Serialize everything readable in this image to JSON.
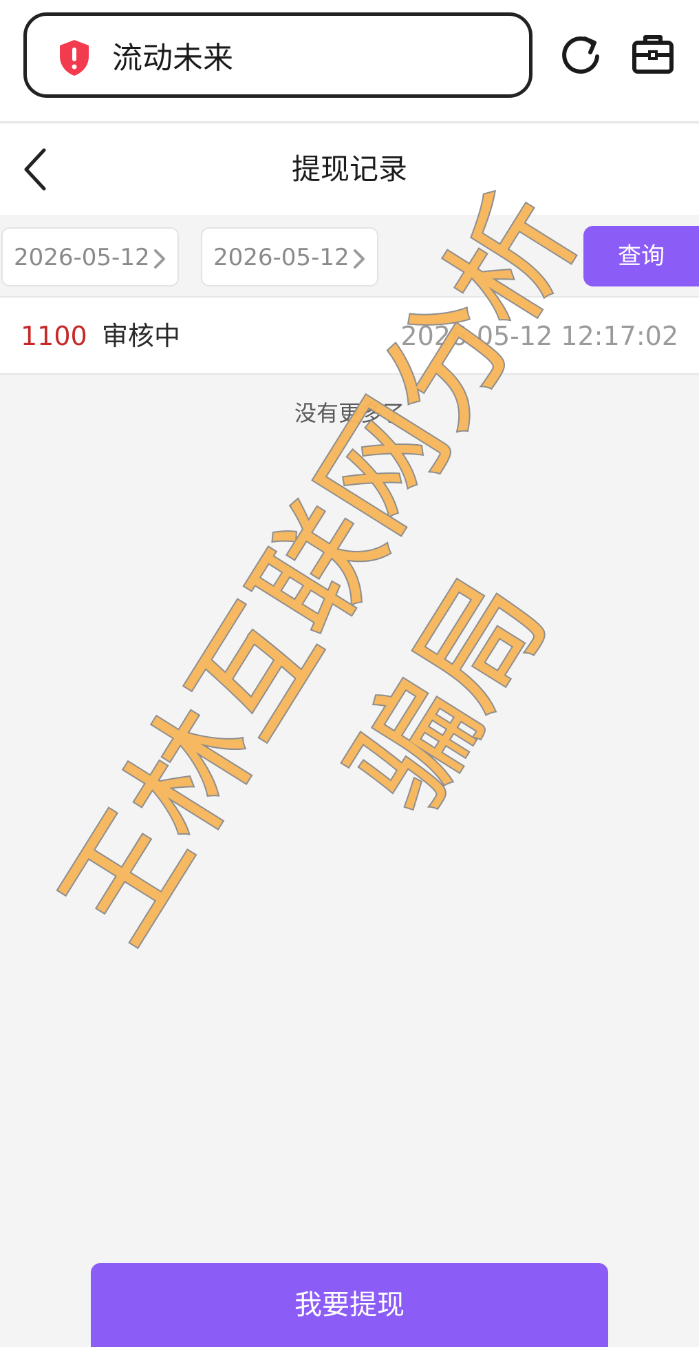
{
  "browser": {
    "site_name": "流动未来",
    "icons": {
      "security": "shield-alert-icon",
      "reload": "reload-icon",
      "toolbox": "toolbox-icon"
    }
  },
  "header": {
    "title": "提现记录",
    "back_icon": "chevron-left-icon"
  },
  "filter": {
    "start_date": "2026-05-12",
    "end_date": "2026-05-12",
    "query_label": "查询"
  },
  "records": [
    {
      "amount": "1100",
      "status": "审核中",
      "time": "2026-05-12 12:17:02"
    }
  ],
  "list_end_text": "没有更多了",
  "withdraw_label": "我要提现",
  "watermark": {
    "line1": "王林互联网分析",
    "line2": "骗局"
  },
  "colors": {
    "accent": "#8b5cf6",
    "amount": "#c62828",
    "shield": "#f23b4f",
    "watermark": "#f7b65a"
  }
}
